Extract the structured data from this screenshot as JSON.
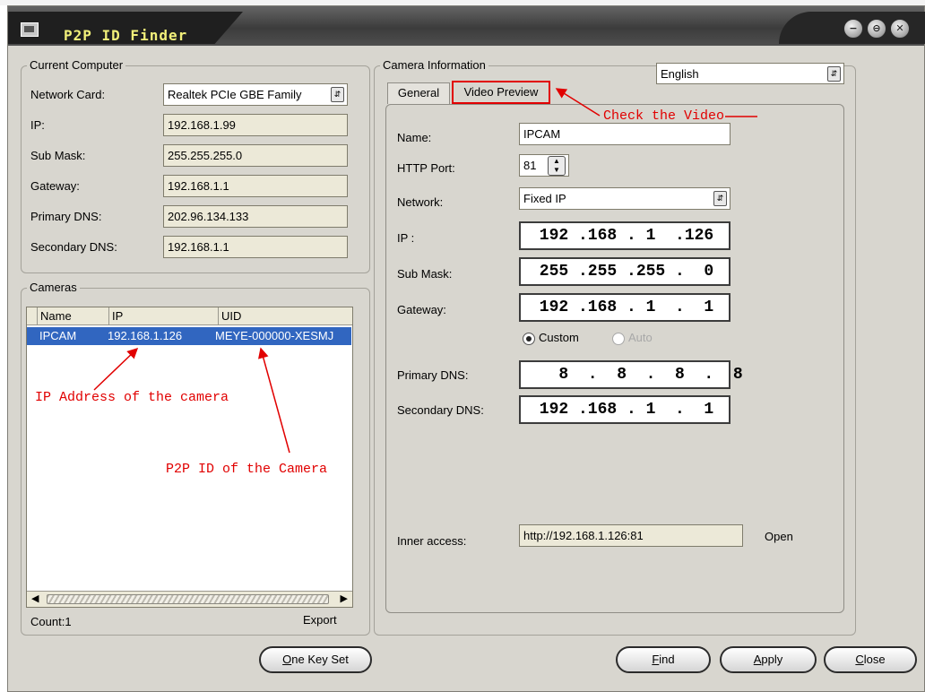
{
  "window": {
    "title": "P2P ID Finder",
    "controls": {
      "minimize": "−",
      "restore": "⊖",
      "close": "✕"
    }
  },
  "current_computer": {
    "legend": "Current Computer",
    "network_card_label": "Network Card:",
    "network_card_value": "Realtek PCIe GBE Family",
    "ip_label": "IP:",
    "ip_value": "192.168.1.99",
    "submask_label": "Sub Mask:",
    "submask_value": "255.255.255.0",
    "gateway_label": "Gateway:",
    "gateway_value": "192.168.1.1",
    "primary_dns_label": "Primary DNS:",
    "primary_dns_value": "202.96.134.133",
    "secondary_dns_label": "Secondary DNS:",
    "secondary_dns_value": "192.168.1.1"
  },
  "cameras": {
    "legend": "Cameras",
    "columns": [
      "Name",
      "IP",
      "UID"
    ],
    "rows": [
      {
        "name": "IPCAM",
        "ip": "192.168.1.126",
        "uid": "MEYE-000000-XESMJ"
      }
    ],
    "count_label": "Count:",
    "count_value": "1",
    "export_label": "Export"
  },
  "camera_info": {
    "legend": "Camera Information",
    "language": "English",
    "tabs": [
      "General",
      "Video Preview"
    ],
    "name_label": "Name:",
    "name_value": "IPCAM",
    "http_port_label": "HTTP Port:",
    "http_port_value": "81",
    "network_label": "Network:",
    "network_value": "Fixed IP",
    "ip_label": "IP :",
    "ip_value": " 192 .168 . 1  .126",
    "submask_label": "Sub Mask:",
    "submask_value": " 255 .255 .255 .  0",
    "gateway_label": "Gateway:",
    "gateway_value": " 192 .168 . 1  .  1",
    "custom_label": "Custom",
    "auto_label": "Auto",
    "primary_dns_label": "Primary DNS:",
    "primary_dns_value": "   8  .  8  .  8  .  8",
    "secondary_dns_label": "Secondary DNS:",
    "secondary_dns_value": " 192 .168 . 1  .  1",
    "inner_access_label": "Inner access:",
    "inner_access_value": "http://192.168.1.126:81",
    "open_label": "Open"
  },
  "buttons": {
    "one_key_set": {
      "underlined": "O",
      "rest": "ne Key Set"
    },
    "find": {
      "underlined": "F",
      "rest": "ind"
    },
    "apply": {
      "underlined": "A",
      "rest": "pply"
    },
    "close": {
      "underlined": "C",
      "rest": "lose"
    }
  },
  "annotations": {
    "check_video": "Check the Video",
    "ip_address": "IP Address of the camera",
    "p2p_id": "P2P ID of the Camera",
    "color": "#e10000"
  },
  "colors": {
    "window_bg": "#d8d6cf",
    "selection": "#3166c0",
    "title_text": "#f2f07a"
  }
}
